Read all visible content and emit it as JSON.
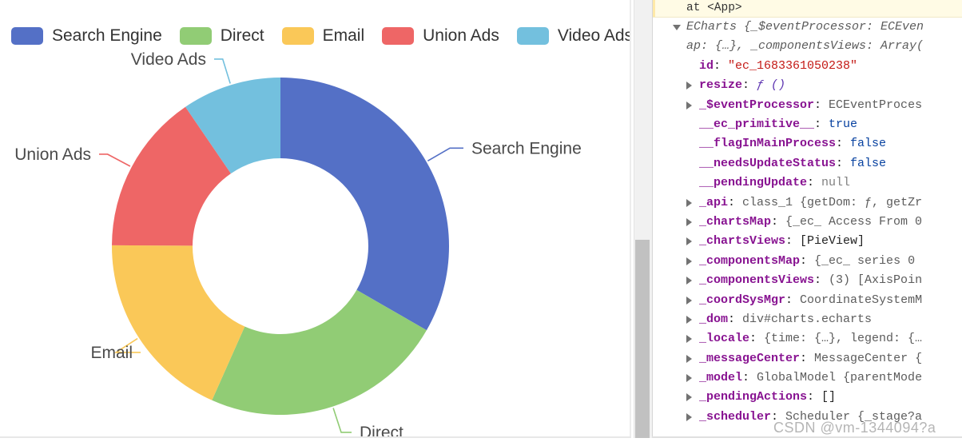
{
  "chart_data": {
    "type": "pie",
    "title": "",
    "subtitle": "",
    "donut": true,
    "legend_position": "top-left",
    "categories": [
      "Search Engine",
      "Direct",
      "Email",
      "Union Ads",
      "Video Ads"
    ],
    "values": [
      1048,
      735,
      580,
      484,
      300
    ],
    "percentages": [
      33.3,
      23.4,
      18.4,
      15.4,
      9.5
    ],
    "colors": [
      "#5470c6",
      "#91cc75",
      "#fac858",
      "#ee6666",
      "#73c0de"
    ],
    "labels": [
      "Search Engine",
      "Direct",
      "Email",
      "Union Ads",
      "Video Ads"
    ],
    "xlabel": "",
    "ylabel": ""
  },
  "chart": {
    "legend": [
      {
        "label": "Search Engine",
        "color": "#5470c6"
      },
      {
        "label": "Direct",
        "color": "#91cc75"
      },
      {
        "label": "Email",
        "color": "#fac858"
      },
      {
        "label": "Union Ads",
        "color": "#ee6666"
      },
      {
        "label": "Video Ads",
        "color": "#73c0de"
      }
    ],
    "slice_labels": {
      "search_engine": "Search Engine",
      "direct": "Direct",
      "email": "Email",
      "union_ads": "Union Ads",
      "video_ads": "Video Ads"
    }
  },
  "devtools": {
    "warning": "at <App>",
    "object_header_line1": "ECharts {_$eventProcessor: ECEven",
    "object_header_line2": "ap: {…}, _componentsViews: Array(",
    "rows": [
      {
        "arrow": false,
        "key": "id",
        "sep": ": ",
        "value": "\"ec_1683361050238\"",
        "vclass": "val-str"
      },
      {
        "arrow": true,
        "key": "resize",
        "sep": ": ",
        "value": "ƒ ()",
        "vclass": "val-fn"
      },
      {
        "arrow": true,
        "key": "_$eventProcessor",
        "sep": ": ",
        "value": "ECEventProces",
        "vclass": "val-cls"
      },
      {
        "arrow": false,
        "key": "__ec_primitive__",
        "sep": ": ",
        "value": "true",
        "vclass": "val-bool"
      },
      {
        "arrow": false,
        "key": "__flagInMainProcess",
        "sep": ": ",
        "value": "false",
        "vclass": "val-bool"
      },
      {
        "arrow": false,
        "key": "__needsUpdateStatus",
        "sep": ": ",
        "value": "false",
        "vclass": "val-bool"
      },
      {
        "arrow": false,
        "key": "__pendingUpdate",
        "sep": ": ",
        "value": "null",
        "vclass": "val-null"
      },
      {
        "arrow": true,
        "key": "_api",
        "sep": ": ",
        "value": "class_1 {getDom: ƒ, getZr",
        "vclass": "val-cls"
      },
      {
        "arrow": true,
        "key": "_chartsMap",
        "sep": ": ",
        "value": "{_ec_ Access From 0",
        "vclass": "val-obj"
      },
      {
        "arrow": true,
        "key": "_chartsViews",
        "sep": ": ",
        "value": "[PieView]",
        "vclass": "val-arr"
      },
      {
        "arrow": true,
        "key": "_componentsMap",
        "sep": ": ",
        "value": "{_ec_ series 0",
        "vclass": "val-obj"
      },
      {
        "arrow": true,
        "key": "_componentsViews",
        "sep": ": ",
        "value": "(3) [AxisPoin",
        "vclass": "val-obj"
      },
      {
        "arrow": true,
        "key": "_coordSysMgr",
        "sep": ": ",
        "value": "CoordinateSystemM",
        "vclass": "val-cls"
      },
      {
        "arrow": true,
        "key": "_dom",
        "sep": ": ",
        "value": "div#charts.echarts",
        "vclass": "val-cls"
      },
      {
        "arrow": true,
        "key": "_locale",
        "sep": ": ",
        "value": "{time: {…}, legend: {…",
        "vclass": "val-obj"
      },
      {
        "arrow": true,
        "key": "_messageCenter",
        "sep": ": ",
        "value": "MessageCenter {",
        "vclass": "val-cls"
      },
      {
        "arrow": true,
        "key": "_model",
        "sep": ": ",
        "value": "GlobalModel {parentMode",
        "vclass": "val-cls"
      },
      {
        "arrow": true,
        "key": "_pendingActions",
        "sep": ": ",
        "value": "[]",
        "vclass": "val-arr"
      },
      {
        "arrow": true,
        "key": "_scheduler",
        "sep": ": ",
        "value": "Scheduler {_stage?a",
        "vclass": "val-cls"
      }
    ]
  },
  "watermark": {
    "text": "CSDN @vm-1344094?a"
  }
}
